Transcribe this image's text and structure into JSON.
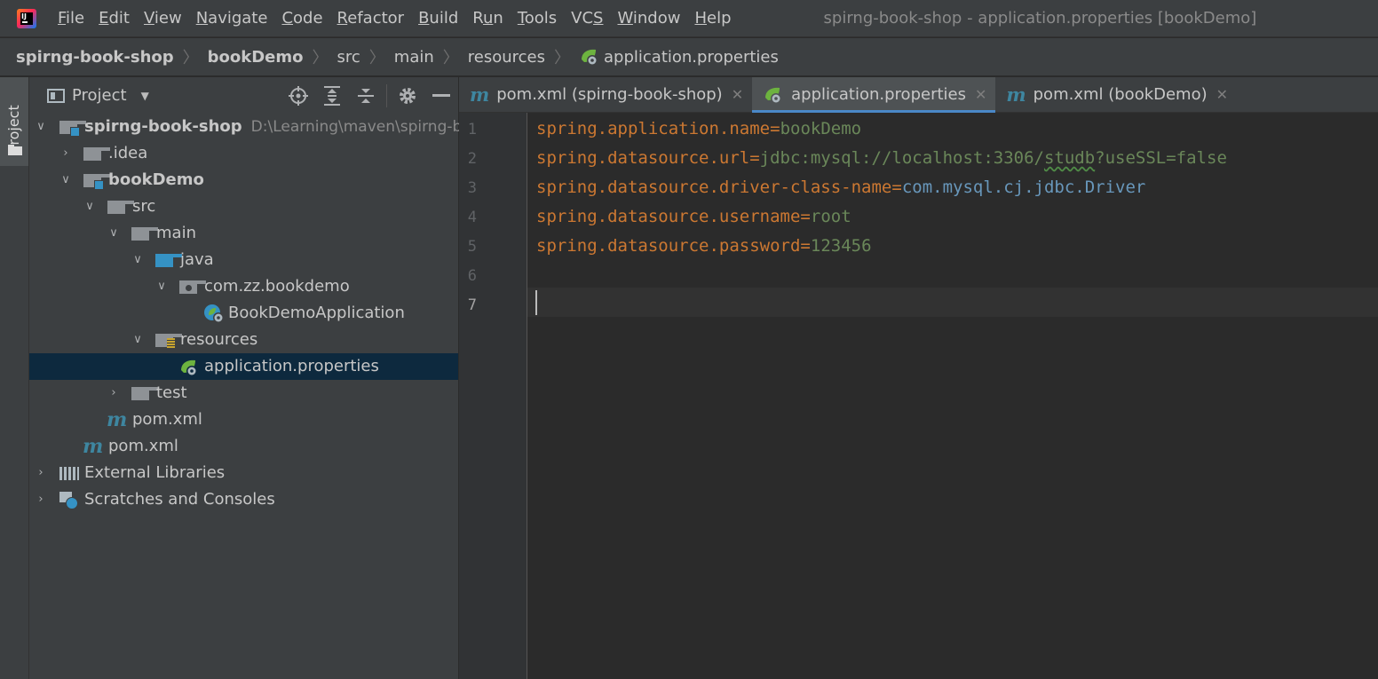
{
  "menubar": {
    "items": [
      {
        "u": "F",
        "rest": "ile"
      },
      {
        "u": "E",
        "rest": "dit"
      },
      {
        "u": "V",
        "rest": "iew"
      },
      {
        "u": "N",
        "rest": "avigate"
      },
      {
        "u": "C",
        "rest": "ode"
      },
      {
        "u": "R",
        "rest": "efactor"
      },
      {
        "u": "B",
        "rest": "uild"
      },
      {
        "pre": "R",
        "u": "u",
        "rest": "n"
      },
      {
        "u": "T",
        "rest": "ools"
      },
      {
        "pre": "VC",
        "u": "S",
        "rest": ""
      },
      {
        "u": "W",
        "rest": "indow"
      },
      {
        "u": "H",
        "rest": "elp"
      }
    ],
    "window_title": "spirng-book-shop - application.properties [bookDemo]",
    "logo_text": "IJ"
  },
  "breadcrumb": {
    "items": [
      "spirng-book-shop",
      "bookDemo",
      "src",
      "main",
      "resources",
      "application.properties"
    ],
    "separator": "〉"
  },
  "tool_stripe": {
    "project_label": "Project"
  },
  "project_panel": {
    "title": "Project",
    "header_icons": [
      "locate-icon",
      "expand-all-icon",
      "collapse-all-icon",
      "gear-icon",
      "hide-icon"
    ],
    "tree": {
      "root_label": "spirng-book-shop",
      "root_path": "D:\\Learning\\maven\\spirng-b",
      "idea": ".idea",
      "bookdemo": "bookDemo",
      "src": "src",
      "main": "main",
      "java": "java",
      "package": "com.zz.bookdemo",
      "app_class": "BookDemoApplication",
      "resources": "resources",
      "app_props": "application.properties",
      "test": "test",
      "pom_inner": "pom.xml",
      "pom_root": "pom.xml",
      "ext_libs": "External Libraries",
      "scratches": "Scratches and Consoles"
    }
  },
  "editor": {
    "tabs": [
      {
        "label": "pom.xml (spirng-book-shop)",
        "icon": "maven-icon",
        "active": false
      },
      {
        "label": "application.properties",
        "icon": "spring-boot-icon",
        "active": true
      },
      {
        "label": "pom.xml (bookDemo)",
        "icon": "maven-icon",
        "active": false
      }
    ],
    "line_numbers": [
      "1",
      "2",
      "3",
      "4",
      "5",
      "6",
      "7"
    ],
    "current_line": 7,
    "lines": [
      {
        "key": "spring.application.name",
        "eq": "=",
        "value": "bookDemo"
      },
      {
        "key": "spring.datasource.url",
        "eq": "=",
        "value_pre": "jdbc:mysql://localhost:3306/",
        "value_typo": "studb",
        "value_post": "?useSSL=false"
      },
      {
        "key": "spring.datasource.driver-class-name",
        "eq": "=",
        "value": "com.mysql.cj.jdbc.Driver"
      },
      {
        "key": "spring.datasource.username",
        "eq": "=",
        "value": "root"
      },
      {
        "key": "spring.datasource.password",
        "eq": "=",
        "value": "123456"
      }
    ],
    "colors": {
      "key": "#cc7832",
      "value_string": "#6a8759",
      "value_class": "#6897bb",
      "background": "#2b2b2b",
      "selection": "#0d293e"
    }
  }
}
